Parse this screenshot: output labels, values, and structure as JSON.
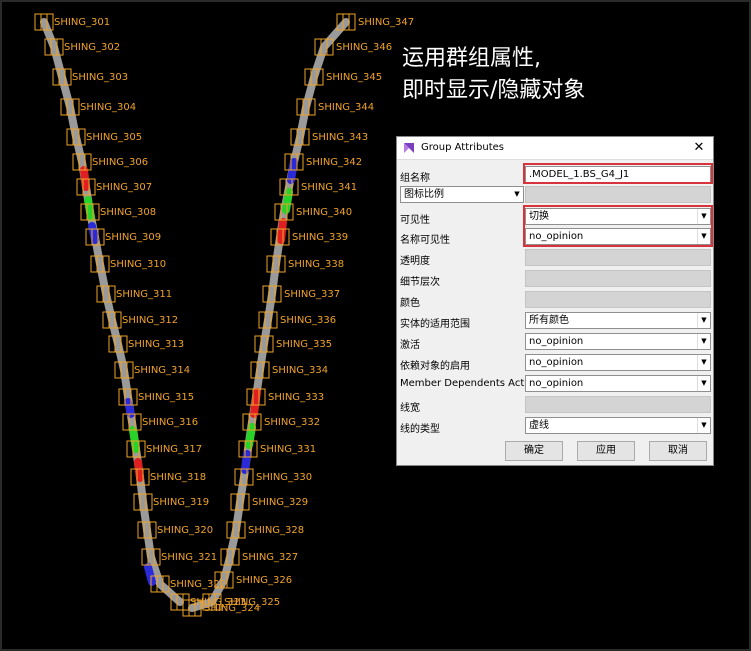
{
  "caption": {
    "line1": "运用群组属性,",
    "line2": "即时显示/隐藏对象"
  },
  "viewport": {
    "left_labels": [
      {
        "text": "SHING_301"
      },
      {
        "text": "SHING_302"
      },
      {
        "text": "SHING_303"
      },
      {
        "text": "SHING_304"
      },
      {
        "text": "SHING_305"
      },
      {
        "text": "SHING_306"
      },
      {
        "text": "SHING_307"
      },
      {
        "text": "SHING_308"
      },
      {
        "text": "SHING_309"
      },
      {
        "text": "SHING_310"
      },
      {
        "text": "SHING_311"
      },
      {
        "text": "SHING_312"
      },
      {
        "text": "SHING_313"
      },
      {
        "text": "SHING_314"
      },
      {
        "text": "SHING_315"
      },
      {
        "text": "SHING_316"
      },
      {
        "text": "SHING_317"
      },
      {
        "text": "SHING_318"
      },
      {
        "text": "SHING_319"
      },
      {
        "text": "SHING_320"
      },
      {
        "text": "SHING_321"
      },
      {
        "text": "SHING_322"
      },
      {
        "text": "SHING_323"
      }
    ],
    "right_labels": [
      {
        "text": "SHING_347"
      },
      {
        "text": "SHING_346"
      },
      {
        "text": "SHING_345"
      },
      {
        "text": "SHING_344"
      },
      {
        "text": "SHING_343"
      },
      {
        "text": "SHING_342"
      },
      {
        "text": "SHING_341"
      },
      {
        "text": "SHING_340"
      },
      {
        "text": "SHING_339"
      },
      {
        "text": "SHING_338"
      },
      {
        "text": "SHING_337"
      },
      {
        "text": "SHING_336"
      },
      {
        "text": "SHING_335"
      },
      {
        "text": "SHING_334"
      },
      {
        "text": "SHING_333"
      },
      {
        "text": "SHING_332"
      },
      {
        "text": "SHING_331"
      },
      {
        "text": "SHING_330"
      },
      {
        "text": "SHING_329"
      },
      {
        "text": "SHING_328"
      },
      {
        "text": "SHING_327"
      },
      {
        "text": "SHING_326"
      },
      {
        "text": "SHING_325"
      },
      {
        "text": "SHING_324"
      }
    ],
    "colors": {
      "label": "#f0a22a",
      "cable": "#9a9a9a",
      "red": "#e02020",
      "green": "#28d228",
      "blue": "#2a2ad8"
    }
  },
  "dialog": {
    "title": "Group Attributes",
    "icon": "app-icon",
    "close_glyph": "✕",
    "rows": {
      "group_name": {
        "label": "组名称",
        "value": ".MODEL_1.BS_G4_J1"
      },
      "icon_scale": {
        "value": "图标比例"
      },
      "visibility": {
        "label": "可见性",
        "value": "切换"
      },
      "name_visibility": {
        "label": "名称可见性",
        "value": "no_opinion"
      },
      "transparency": {
        "label": "透明度"
      },
      "detail_level": {
        "label": "细节层次"
      },
      "color": {
        "label": "颜色"
      },
      "solid_scope": {
        "label": "实体的适用范围",
        "value": "所有颜色"
      },
      "activate": {
        "label": "激活",
        "value": "no_opinion"
      },
      "dependents_enable": {
        "label": "依赖对象的启用",
        "value": "no_opinion"
      },
      "member_dependents_active": {
        "label": "Member Dependents Active",
        "value": "no_opinion"
      },
      "line_width": {
        "label": "线宽"
      },
      "line_type": {
        "label": "线的类型",
        "value": "虚线"
      }
    },
    "buttons": {
      "ok": "确定",
      "apply": "应用",
      "cancel": "取消"
    },
    "highlight_color": "#d8323c"
  }
}
